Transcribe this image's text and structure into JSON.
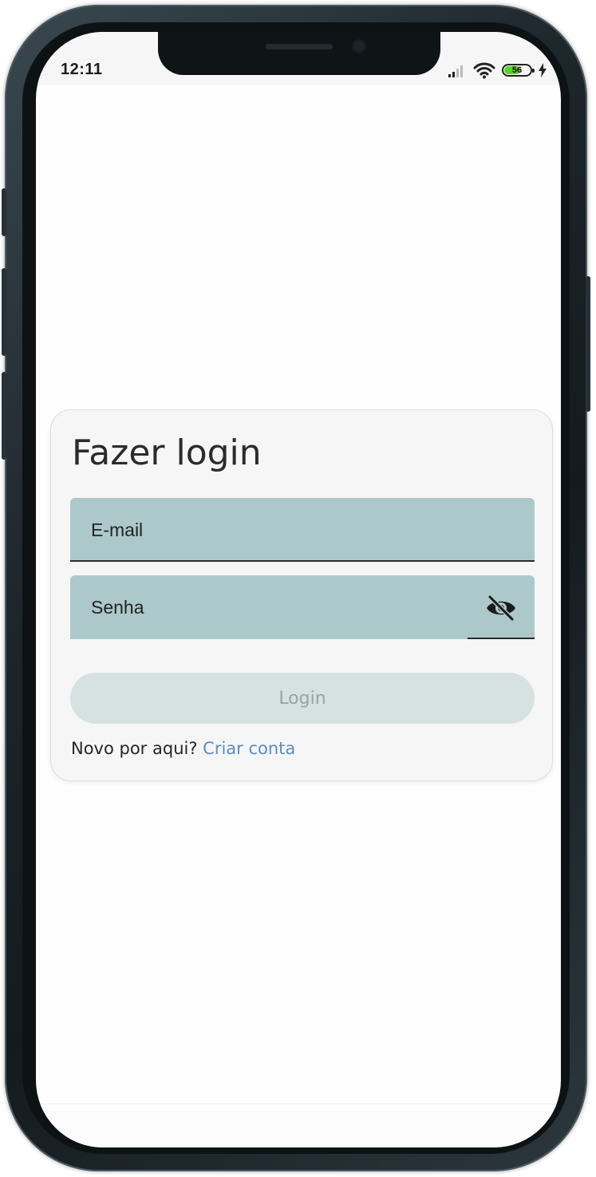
{
  "status_bar": {
    "time": "12:11",
    "battery_level": "56",
    "icons": [
      "signal-icon",
      "wifi-icon",
      "battery-icon",
      "charging-icon"
    ]
  },
  "login_card": {
    "title": "Fazer login",
    "email_field": {
      "label": "E-mail",
      "value": ""
    },
    "password_field": {
      "label": "Senha",
      "value": "",
      "toggle_icon": "eye-off-icon"
    },
    "login_button": "Login",
    "signup_prompt": "Novo por aqui?",
    "signup_link": "Criar conta"
  },
  "colors": {
    "field_background": "#adc8cb",
    "card_background": "#f6f6f6",
    "button_disabled": "#d6e1e1",
    "link": "#5a8ec4"
  }
}
